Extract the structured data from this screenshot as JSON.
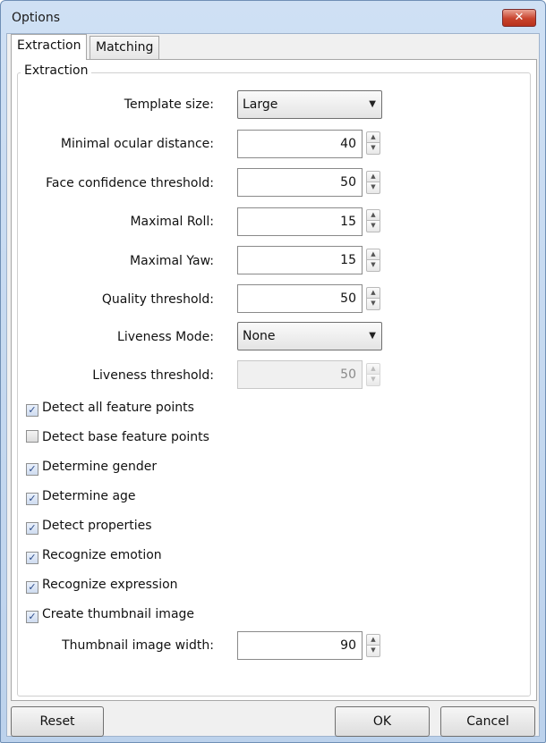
{
  "window": {
    "title": "Options",
    "close_glyph": "✕"
  },
  "tabs": [
    {
      "label": "Extraction",
      "active": true
    },
    {
      "label": "Matching",
      "active": false
    }
  ],
  "group": {
    "label": "Extraction"
  },
  "fields": {
    "template_size": {
      "label": "Template size:",
      "value": "Large"
    },
    "min_ocular": {
      "label": "Minimal ocular distance:",
      "value": "40"
    },
    "face_conf": {
      "label": "Face confidence threshold:",
      "value": "50"
    },
    "max_roll": {
      "label": "Maximal Roll:",
      "value": "15"
    },
    "max_yaw": {
      "label": "Maximal Yaw:",
      "value": "15"
    },
    "quality": {
      "label": "Quality threshold:",
      "value": "50"
    },
    "liveness_mode": {
      "label": "Liveness Mode:",
      "value": "None"
    },
    "liveness_threshold": {
      "label": "Liveness threshold:",
      "value": "50",
      "disabled": true
    },
    "thumb_width": {
      "label": "Thumbnail image width:",
      "value": "90"
    }
  },
  "checkboxes": [
    {
      "label": "Detect all feature points",
      "checked": true
    },
    {
      "label": "Detect base feature points",
      "checked": false
    },
    {
      "label": "Determine gender",
      "checked": true
    },
    {
      "label": "Determine age",
      "checked": true
    },
    {
      "label": "Detect properties",
      "checked": true
    },
    {
      "label": "Recognize emotion",
      "checked": true
    },
    {
      "label": "Recognize expression",
      "checked": true
    },
    {
      "label": "Create thumbnail image",
      "checked": true
    }
  ],
  "buttons": {
    "reset": "Reset",
    "ok": "OK",
    "cancel": "Cancel"
  },
  "icons": {
    "combo_arrow": "▼",
    "spin_up": "▲",
    "spin_down": "▼",
    "check_mark": "✓"
  },
  "colors": {
    "titlebar": "#cfe0f4",
    "close": "#c8432c",
    "panel": "#ffffff",
    "client": "#f0f0f0"
  }
}
